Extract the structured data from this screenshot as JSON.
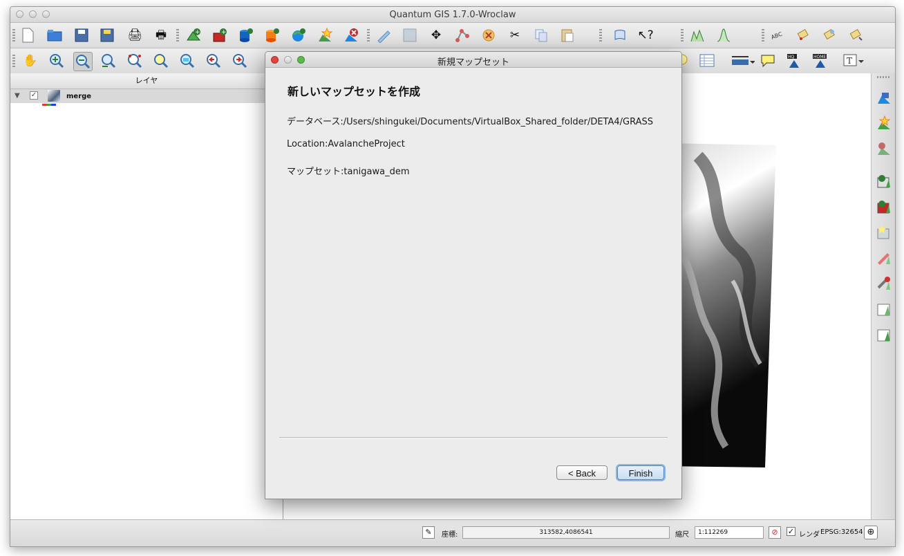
{
  "window": {
    "title": "Quantum GIS 1.7.0-Wroclaw"
  },
  "toolbar1": {
    "icons": [
      "new-project-icon",
      "open-project-icon",
      "save-project-icon",
      "save-as-icon",
      "print-composer-icon",
      "print-icon",
      "add-vector-layer-icon",
      "add-raster-layer-icon",
      "add-postgis-layer-icon",
      "add-spatialite-layer-icon",
      "add-wms-layer-icon",
      "new-vector-layer-icon",
      "remove-layer-icon",
      "toggle-editing-icon",
      "save-edits-icon",
      "move-feature-icon",
      "node-tool-icon",
      "delete-selected-icon",
      "cut-features-icon",
      "copy-features-icon",
      "paste-features-icon",
      "help-icon",
      "whats-this-icon",
      "raster-histogram-icon",
      "raster-stretch-icon",
      "label-icon",
      "pin-label-icon",
      "show-hide-label-icon",
      "move-label-icon"
    ]
  },
  "toolbar2": {
    "icons": [
      "pan-icon",
      "zoom-in-icon",
      "zoom-out-icon",
      "zoom-full-icon",
      "zoom-selection-icon",
      "zoom-layer-icon",
      "zoom-actual-icon",
      "zoom-last-icon",
      "zoom-next-icon",
      "map-tips-icon",
      "attribute-table-icon",
      "measure-icon",
      "annotation-icon",
      "hq-icon",
      "home-icon",
      "text-annotation-icon"
    ]
  },
  "layers_panel": {
    "title": "レイヤ",
    "layers": [
      {
        "name": "merge",
        "checked": true
      }
    ]
  },
  "right_toolbar": {
    "icons": [
      "add-raster-icon",
      "new-vector-icon",
      "remove-icon",
      "add-layer-green-icon",
      "add-layer-red-icon",
      "edit-layer-icon",
      "grass-edit-icon",
      "grass-tools-icon",
      "grass-region-icon",
      "grass-region-edit-icon"
    ]
  },
  "status_bar": {
    "coordinate_label": "座標:",
    "coordinate_value": "313582,4086541",
    "scale_label": "縮尺",
    "scale_value": "1:112269",
    "render_label": "レンダ",
    "render_checked": true,
    "crs": "EPSG:32654"
  },
  "dialog": {
    "title": "新規マップセット",
    "heading": "新しいマップセットを作成",
    "database_line": "データベース:/Users/shingukei/Documents/VirtualBox_Shared_folder/DETA4/GRASS",
    "location_line": "Location:AvalancheProject",
    "mapset_line": "マップセット:tanigawa_dem",
    "back_label": "< Back",
    "finish_label": "Finish"
  },
  "colors": {
    "finish_border": "#5a86b8",
    "close_red": "#e0443e",
    "minimize_yellow": "#dfa534",
    "zoom_green": "#5fb94a"
  }
}
